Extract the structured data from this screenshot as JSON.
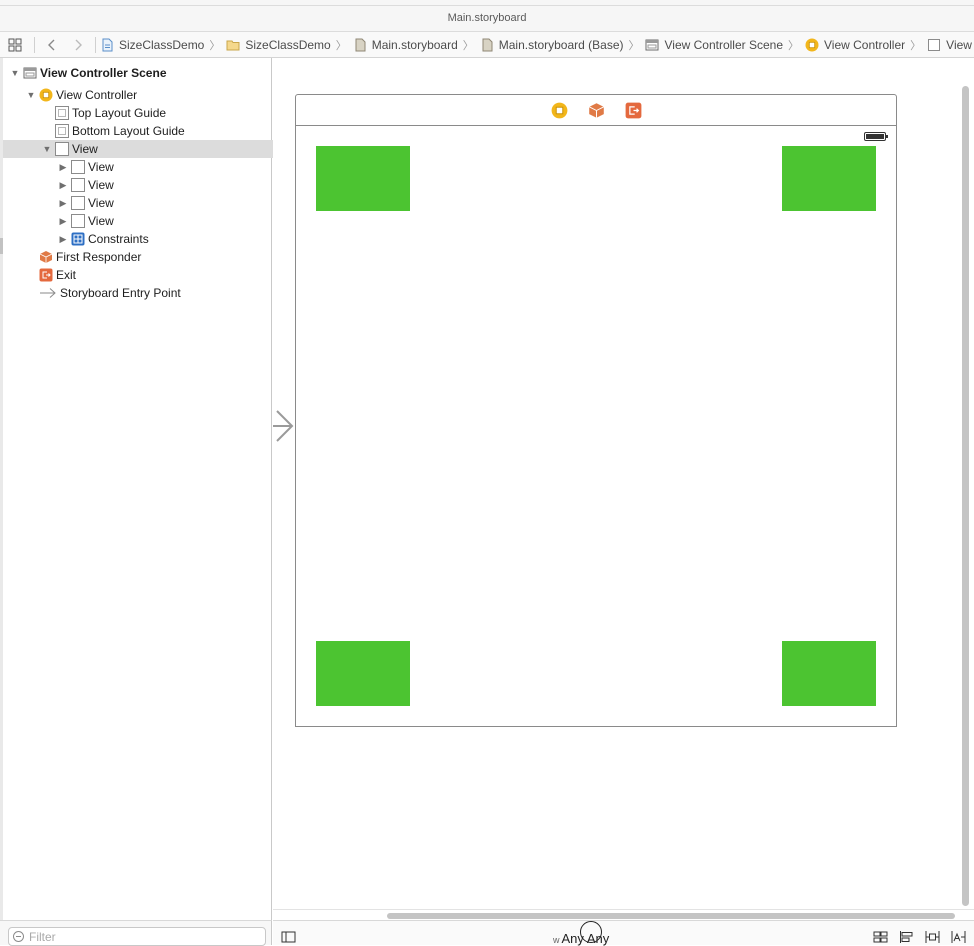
{
  "window": {
    "title": "Main.storyboard"
  },
  "jumpbar": {
    "crumbs": [
      {
        "label": "SizeClassDemo",
        "icon": "project-icon"
      },
      {
        "label": "SizeClassDemo",
        "icon": "folder-icon"
      },
      {
        "label": "Main.storyboard",
        "icon": "storyboard-file-icon"
      },
      {
        "label": "Main.storyboard (Base)",
        "icon": "storyboard-file-icon"
      },
      {
        "label": "View Controller Scene",
        "icon": "scene-icon"
      },
      {
        "label": "View Controller",
        "icon": "view-controller-icon"
      },
      {
        "label": "View",
        "icon": "view-icon"
      }
    ]
  },
  "outline": {
    "items": [
      {
        "label": "View Controller Scene",
        "icon": "scene-icon"
      },
      {
        "label": "View Controller",
        "icon": "view-controller-icon"
      },
      {
        "label": "Top Layout Guide",
        "icon": "layout-guide-icon"
      },
      {
        "label": "Bottom Layout Guide",
        "icon": "layout-guide-icon"
      },
      {
        "label": "View",
        "icon": "view-icon",
        "selected": true
      },
      {
        "label": "View",
        "icon": "view-icon"
      },
      {
        "label": "View",
        "icon": "view-icon"
      },
      {
        "label": "View",
        "icon": "view-icon"
      },
      {
        "label": "View",
        "icon": "view-icon"
      },
      {
        "label": "Constraints",
        "icon": "constraints-icon"
      },
      {
        "label": "First Responder",
        "icon": "first-responder-icon"
      },
      {
        "label": "Exit",
        "icon": "exit-icon"
      },
      {
        "label": "Storyboard Entry Point",
        "icon": "entry-point-arrow-icon"
      }
    ]
  },
  "filter": {
    "placeholder": "Filter"
  },
  "size_class": {
    "w_prefix": "w",
    "width": "Any",
    "height": "Any"
  },
  "colors": {
    "subview_green": "#4cc431",
    "view_controller_yellow": "#f2b61b",
    "first_responder_orange": "#e07a46",
    "exit_orange": "#e4693e",
    "constraints_blue": "#2d6fc4"
  }
}
